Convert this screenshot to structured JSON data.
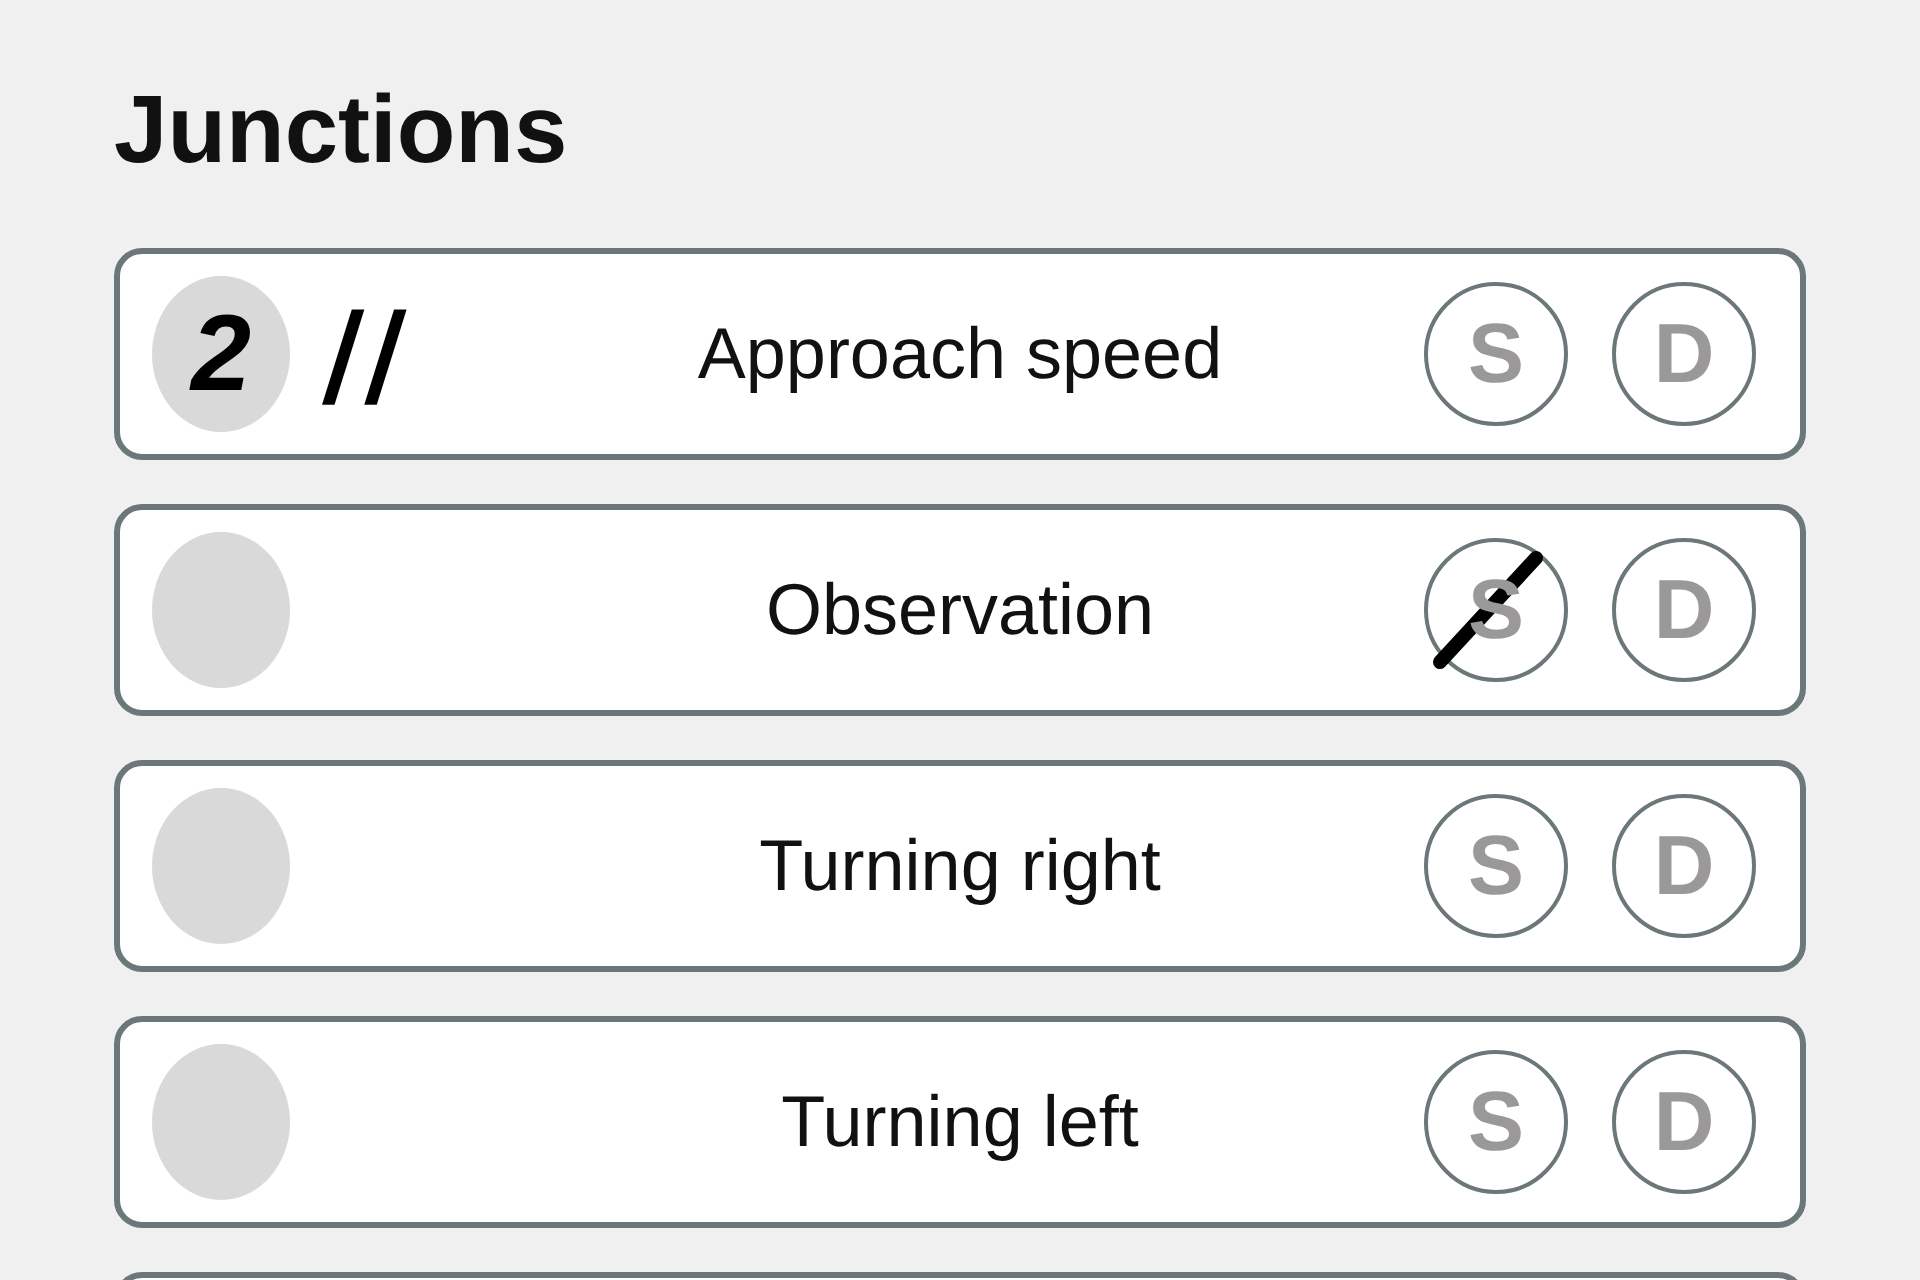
{
  "title": "Junctions",
  "rows": [
    {
      "count": "2",
      "tally": "//",
      "label": "Approach speed",
      "buttons": [
        {
          "label": "S",
          "struck": false
        },
        {
          "label": "D",
          "struck": false
        }
      ]
    },
    {
      "label": "Observation",
      "buttons": [
        {
          "label": "S",
          "struck": true
        },
        {
          "label": "D",
          "struck": false
        }
      ]
    },
    {
      "label": "Turning right",
      "buttons": [
        {
          "label": "S",
          "struck": false
        },
        {
          "label": "D",
          "struck": false
        }
      ]
    },
    {
      "label": "Turning left",
      "buttons": [
        {
          "label": "S",
          "struck": false
        },
        {
          "label": "D",
          "struck": false
        }
      ]
    }
  ]
}
